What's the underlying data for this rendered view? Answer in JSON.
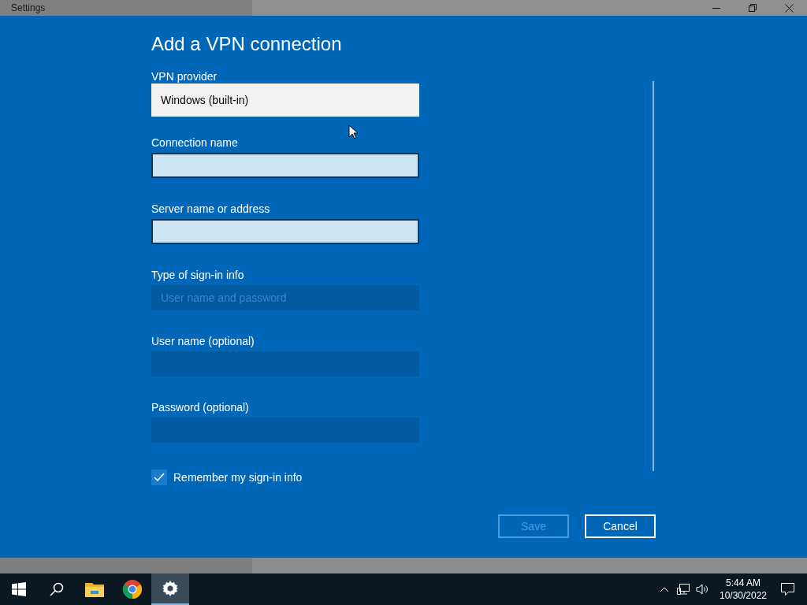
{
  "window": {
    "title": "Settings"
  },
  "dialog": {
    "title": "Add a VPN connection",
    "fields": [
      {
        "kind": "dropdown",
        "label": "VPN provider",
        "value": "Windows (built-in)",
        "disabled": false
      },
      {
        "kind": "text",
        "label": "Connection name",
        "disabled": false
      },
      {
        "kind": "text",
        "label": "Server name or address",
        "disabled": false
      },
      {
        "kind": "dropdown",
        "label": "Type of sign-in info",
        "value": "User name and password",
        "disabled": true
      },
      {
        "kind": "text",
        "label": "User name (optional)",
        "disabled": true
      },
      {
        "kind": "password",
        "label": "Password (optional)",
        "disabled": true
      }
    ],
    "remember": {
      "label": "Remember my sign-in info",
      "checked": true
    },
    "buttons": [
      {
        "label": "Save",
        "disabled": true
      },
      {
        "label": "Cancel",
        "disabled": false
      }
    ]
  },
  "taskbar": {
    "apps": [
      {
        "kind": "start",
        "selected": false
      },
      {
        "kind": "search",
        "selected": false
      },
      {
        "kind": "files",
        "selected": false
      },
      {
        "kind": "browser",
        "selected": false
      },
      {
        "kind": "settings",
        "selected": true
      }
    ],
    "time": "5:44 AM",
    "date": "10/30/2022"
  }
}
